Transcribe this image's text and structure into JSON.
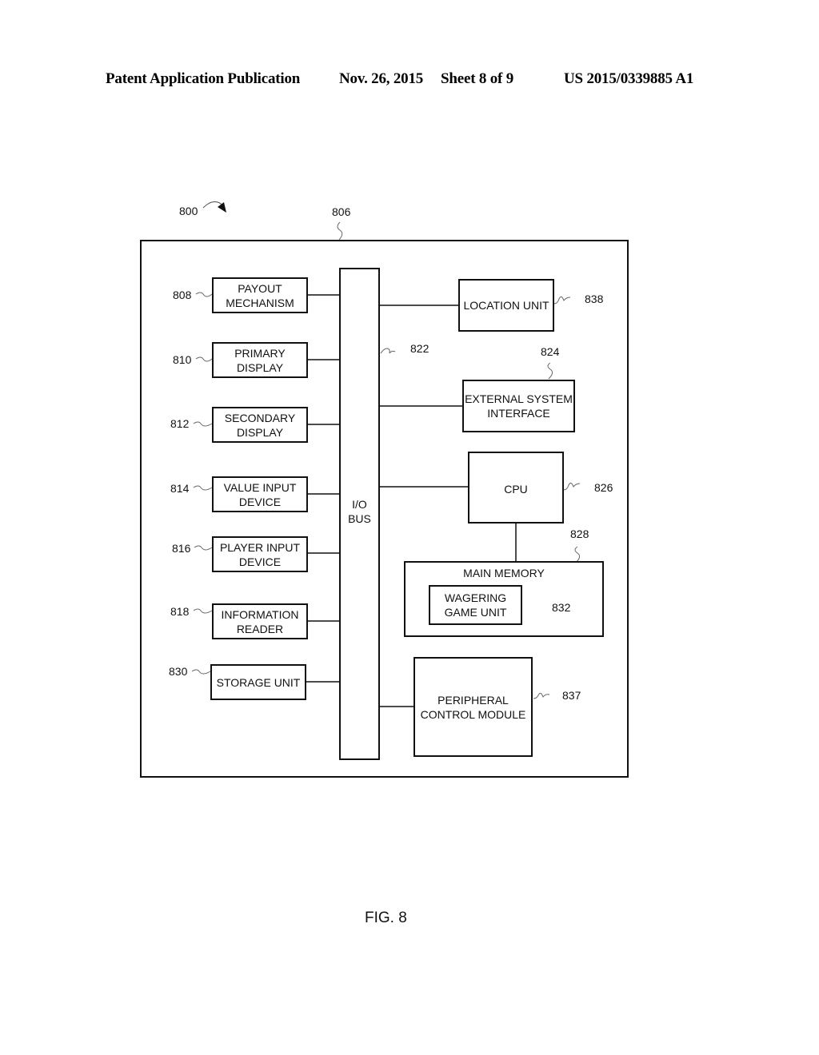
{
  "header": {
    "publication": "Patent Application Publication",
    "date": "Nov. 26, 2015",
    "sheet": "Sheet 8 of 9",
    "number": "US 2015/0339885 A1"
  },
  "figure": {
    "ref": "800",
    "caption": "FIG. 8",
    "enclosure_ref": "806"
  },
  "bus": {
    "label": "I/O\nBUS",
    "ref": "822"
  },
  "left_blocks": [
    {
      "ref": "808",
      "label": "PAYOUT\nMECHANISM"
    },
    {
      "ref": "810",
      "label": "PRIMARY\nDISPLAY"
    },
    {
      "ref": "812",
      "label": "SECONDARY\nDISPLAY"
    },
    {
      "ref": "814",
      "label": "VALUE INPUT\nDEVICE"
    },
    {
      "ref": "816",
      "label": "PLAYER INPUT\nDEVICE"
    },
    {
      "ref": "818",
      "label": "INFORMATION\nREADER"
    },
    {
      "ref": "830",
      "label": "STORAGE UNIT"
    }
  ],
  "right_blocks": {
    "location_unit": {
      "ref": "838",
      "label": "LOCATION UNIT"
    },
    "external_system_interface": {
      "ref": "824",
      "label": "EXTERNAL SYSTEM\nINTERFACE"
    },
    "cpu": {
      "ref": "826",
      "label": "CPU"
    },
    "main_memory": {
      "ref": "828",
      "label": "MAIN MEMORY"
    },
    "wagering_game_unit": {
      "ref": "832",
      "label": "WAGERING\nGAME UNIT"
    },
    "peripheral_control_module": {
      "ref": "837",
      "label": "PERIPHERAL\nCONTROL MODULE"
    }
  }
}
